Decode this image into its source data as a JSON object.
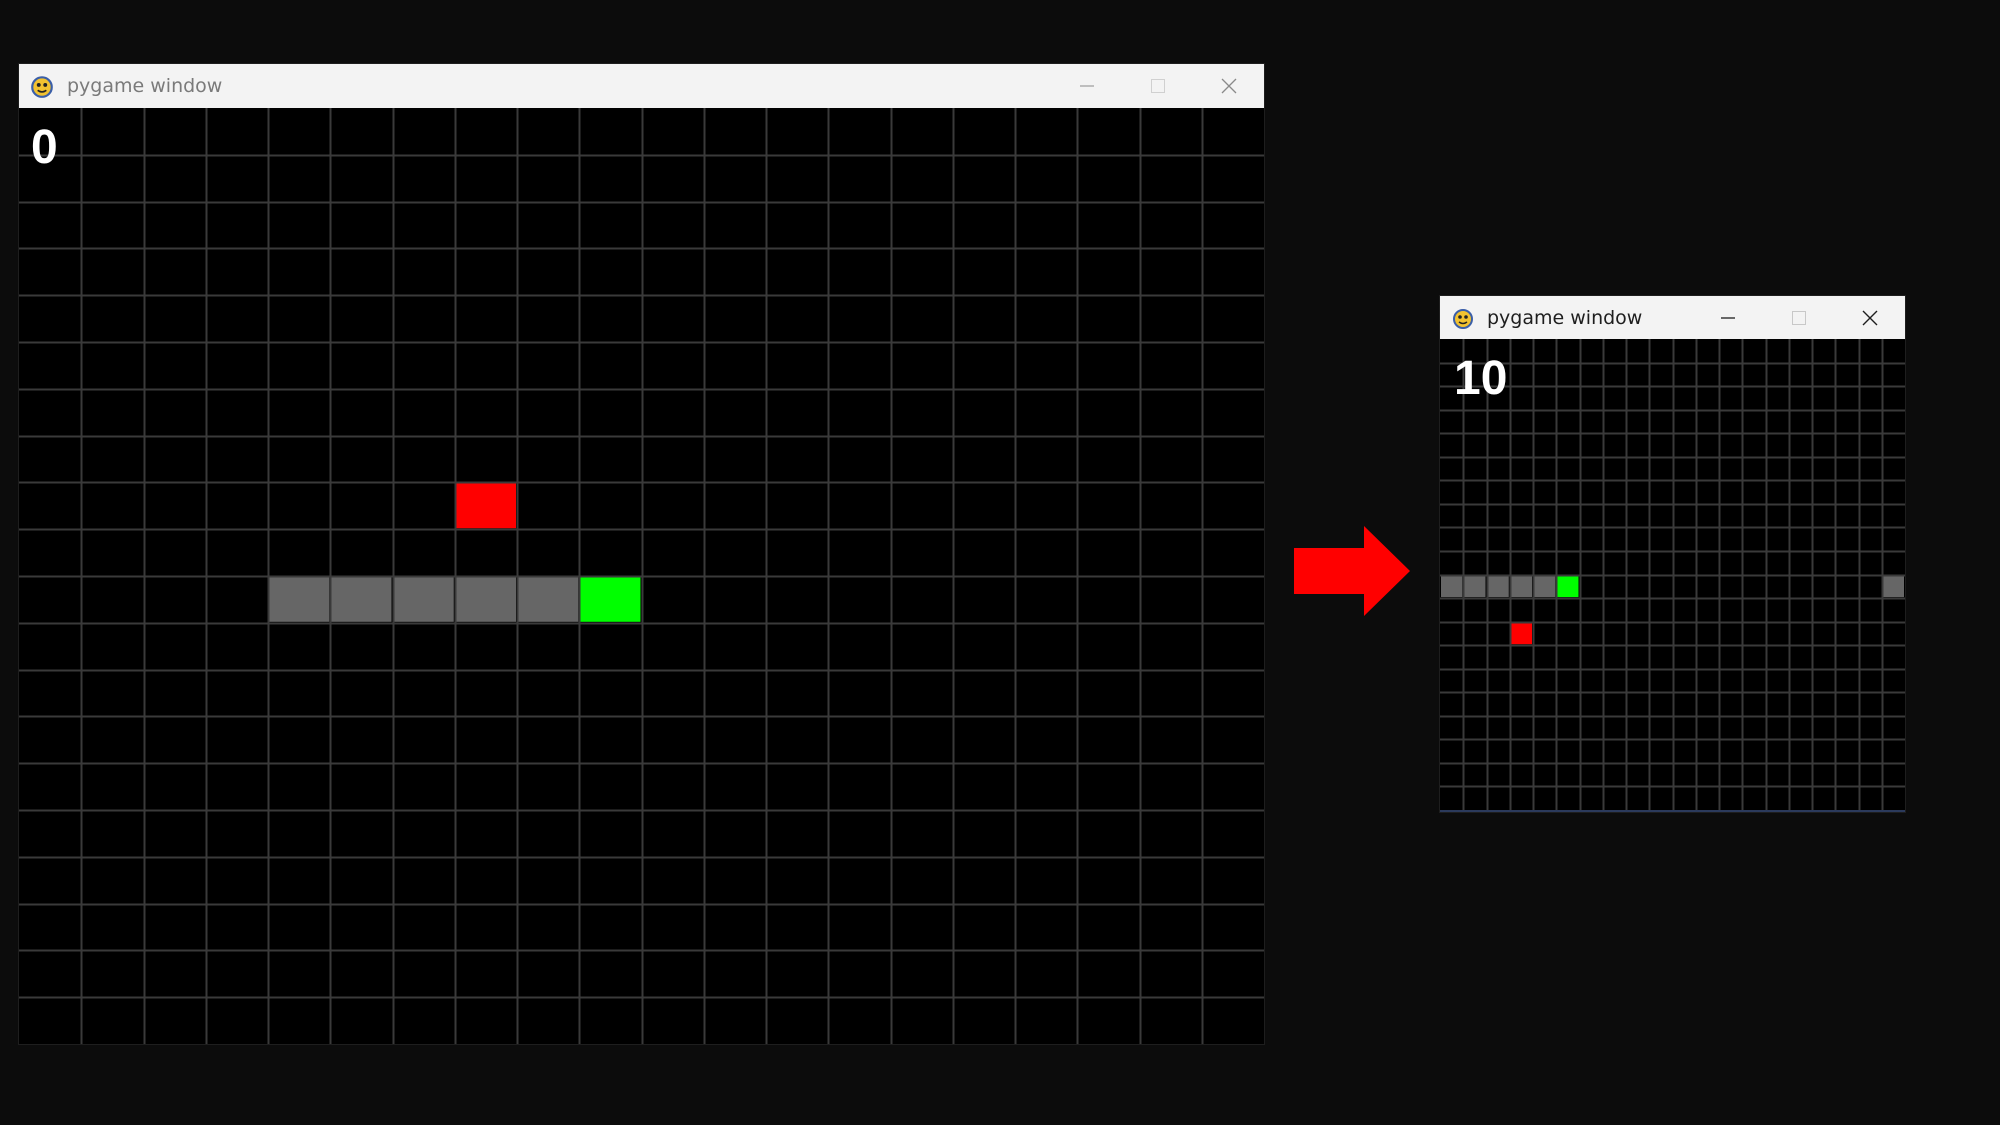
{
  "colors": {
    "background": "#0c0c0c",
    "grid_line": "#3a3a3a",
    "snake_body": "#666666",
    "snake_head": "#00ff00",
    "food": "#ff0000",
    "arrow": "#ff0000"
  },
  "windows": [
    {
      "title": "pygame window",
      "icon": "pygame-snake-icon",
      "controls": [
        "minimize-icon",
        "maximize-icon",
        "close-icon"
      ],
      "score": "0",
      "grid": {
        "cols": 20,
        "rows": 20
      },
      "snake_body": [
        [
          4,
          10
        ],
        [
          5,
          10
        ],
        [
          6,
          10
        ],
        [
          7,
          10
        ],
        [
          8,
          10
        ]
      ],
      "snake_head": [
        9,
        10
      ],
      "food": [
        [
          7,
          8
        ]
      ]
    },
    {
      "title": "pygame window",
      "icon": "pygame-snake-icon",
      "controls": [
        "minimize-icon",
        "maximize-icon",
        "close-icon"
      ],
      "score": "10",
      "grid": {
        "cols": 20,
        "rows": 20
      },
      "snake_body": [
        [
          0,
          10
        ],
        [
          1,
          10
        ],
        [
          2,
          10
        ],
        [
          3,
          10
        ],
        [
          4,
          10
        ],
        [
          19,
          10
        ]
      ],
      "snake_head": [
        5,
        10
      ],
      "food": [
        [
          3,
          12
        ]
      ]
    }
  ],
  "transition_arrow": "right-arrow-icon"
}
